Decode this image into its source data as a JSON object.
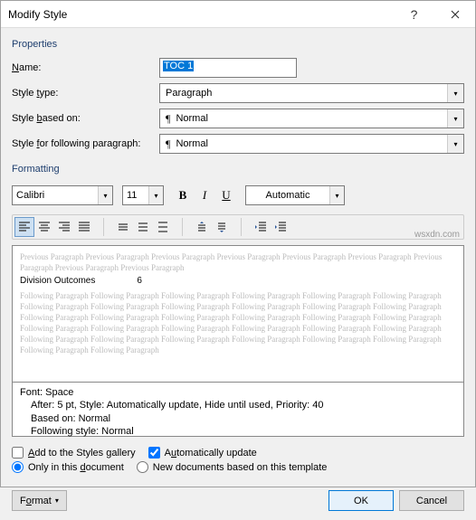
{
  "titlebar": {
    "title": "Modify Style"
  },
  "groups": {
    "properties": "Properties",
    "formatting": "Formatting"
  },
  "labels": {
    "name": "Name:",
    "style_type": "Style type:",
    "style_based_on": "Style based on:",
    "style_following": "Style for following paragraph:"
  },
  "accel": {
    "name": "N",
    "type": "t",
    "based": "b",
    "following": "f",
    "add_gallery": "A",
    "auto_update": "u",
    "only_doc": "d",
    "template": "t",
    "format": "o"
  },
  "values": {
    "name": "TOC 1",
    "style_type": "Paragraph",
    "style_based_on": "Normal",
    "style_following": "Normal",
    "font_name": "Calibri",
    "font_size": "11",
    "font_color": "Automatic"
  },
  "preview": {
    "prev": "Previous Paragraph Previous Paragraph Previous Paragraph Previous Paragraph Previous Paragraph Previous Paragraph Previous Paragraph Previous Paragraph Previous Paragraph",
    "sample_text": "Division Outcomes",
    "sample_num": "6",
    "next": "Following Paragraph Following Paragraph Following Paragraph Following Paragraph Following Paragraph Following Paragraph Following Paragraph Following Paragraph Following Paragraph Following Paragraph Following Paragraph Following Paragraph Following Paragraph Following Paragraph Following Paragraph Following Paragraph Following Paragraph Following Paragraph Following Paragraph Following Paragraph Following Paragraph Following Paragraph Following Paragraph Following Paragraph Following Paragraph Following Paragraph Following Paragraph Following Paragraph Following Paragraph Following Paragraph Following Paragraph Following Paragraph"
  },
  "description": {
    "line1": "Font: Space",
    "line2": "After:  5 pt, Style: Automatically update, Hide until used, Priority: 40",
    "line3": "Based on: Normal",
    "line4": "Following style: Normal"
  },
  "checks": {
    "add_gallery": "Add to the Styles gallery",
    "auto_update": "Automatically update",
    "only_doc": "Only in this document",
    "template": "New documents based on this template"
  },
  "buttons": {
    "format": "Format",
    "ok": "OK",
    "cancel": "Cancel"
  },
  "watermark": "wsxdn.com"
}
